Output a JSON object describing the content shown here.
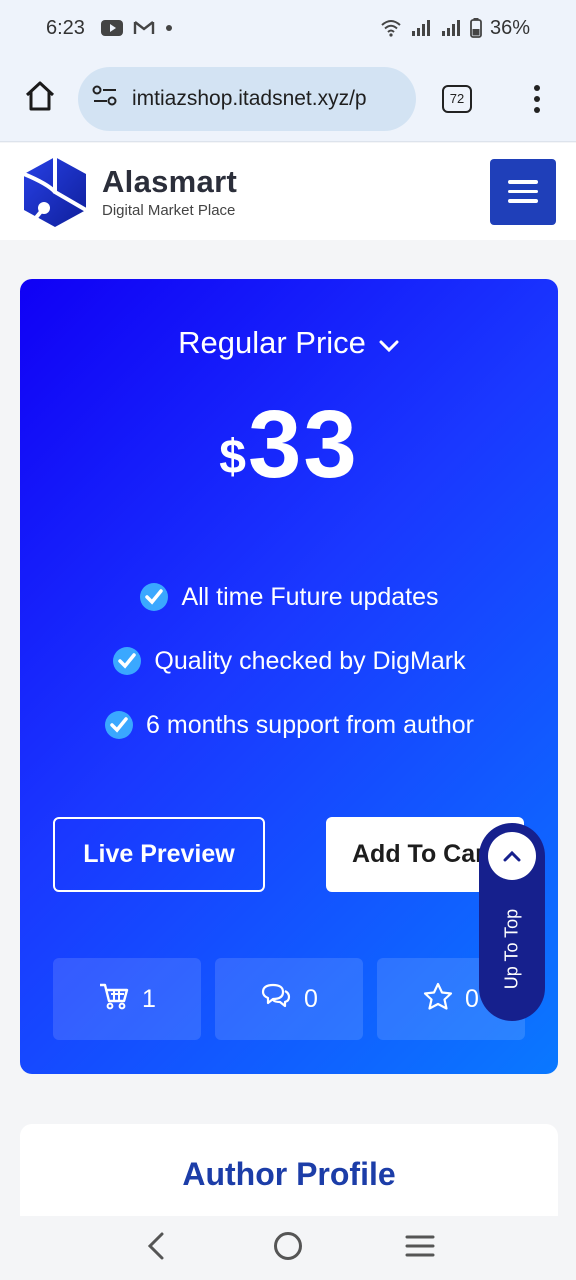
{
  "status": {
    "time": "6:23",
    "battery": "36%",
    "notification_icons": [
      "youtube-icon",
      "gmail-icon",
      "dot-icon"
    ]
  },
  "browser": {
    "url": "imtiazshop.itadsnet.xyz/p",
    "tab_count": "72"
  },
  "site": {
    "brand_name": "Alasmart",
    "brand_tagline": "Digital Market Place"
  },
  "pricing": {
    "price_type": "Regular Price",
    "currency": "$",
    "amount": "33",
    "features": [
      "All time Future updates",
      "Quality checked by DigMark",
      "6 months support from author"
    ],
    "live_preview_label": "Live Preview",
    "add_to_cart_label": "Add To Cart",
    "stats": {
      "sales": "1",
      "comments": "0",
      "rating": "0"
    }
  },
  "up_to_top_label": "Up To Top",
  "author": {
    "title": "Author Profile"
  },
  "colors": {
    "card_gradient_start": "#1000f5",
    "card_gradient_end": "#0a78ff",
    "hamburger_bg": "#1f3fb9",
    "up_to_top_bg": "#16208d",
    "author_title": "#1c3da8"
  }
}
